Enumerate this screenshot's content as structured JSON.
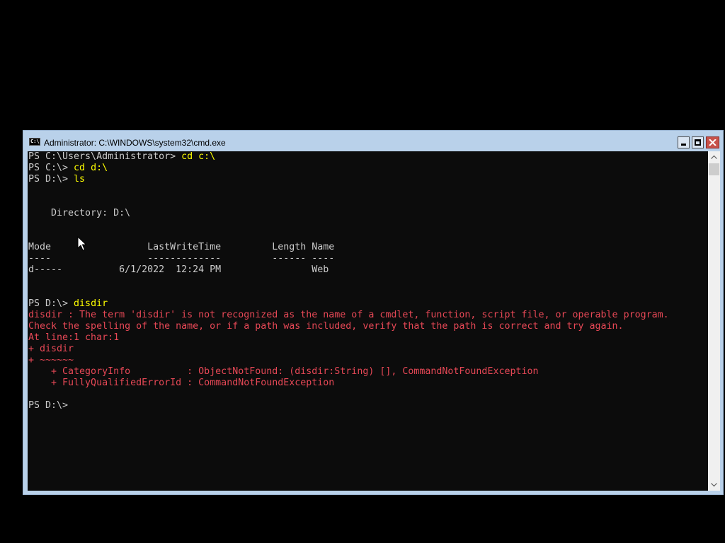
{
  "window": {
    "title": "Administrator: C:\\WINDOWS\\system32\\cmd.exe",
    "icon": "console-app-icon",
    "controls": {
      "minimize": "minimize-icon",
      "maximize": "maximize-icon",
      "close": "close-icon"
    }
  },
  "colors": {
    "titlebar": "#b9d1ea",
    "console_background": "#0c0c0c",
    "console_text": "#cccccc",
    "error_text": "#e74856",
    "command_text": "#ffff00",
    "close_button": "#c7514a"
  },
  "console": {
    "lines": [
      {
        "type": "input",
        "prompt": "PS C:\\Users\\Administrator> ",
        "command": "cd c:\\"
      },
      {
        "type": "input",
        "prompt": "PS C:\\> ",
        "command": "cd d:\\"
      },
      {
        "type": "input",
        "prompt": "PS D:\\> ",
        "command": "ls"
      },
      {
        "type": "output",
        "text": ""
      },
      {
        "type": "output",
        "text": ""
      },
      {
        "type": "output",
        "text": "    Directory: D:\\"
      },
      {
        "type": "output",
        "text": ""
      },
      {
        "type": "output",
        "text": ""
      },
      {
        "type": "output",
        "text": "Mode                 LastWriteTime         Length Name"
      },
      {
        "type": "output",
        "text": "----                 -------------         ------ ----"
      },
      {
        "type": "output",
        "text": "d-----          6/1/2022  12:24 PM                Web"
      },
      {
        "type": "output",
        "text": ""
      },
      {
        "type": "output",
        "text": ""
      },
      {
        "type": "input",
        "prompt": "PS D:\\> ",
        "command": "disdir"
      },
      {
        "type": "error",
        "text": "disdir : The term 'disdir' is not recognized as the name of a cmdlet, function, script file, or operable program."
      },
      {
        "type": "error",
        "text": "Check the spelling of the name, or if a path was included, verify that the path is correct and try again."
      },
      {
        "type": "error",
        "text": "At line:1 char:1"
      },
      {
        "type": "error",
        "text": "+ disdir"
      },
      {
        "type": "error",
        "text": "+ ~~~~~~"
      },
      {
        "type": "error",
        "text": "    + CategoryInfo          : ObjectNotFound: (disdir:String) [], CommandNotFoundException"
      },
      {
        "type": "error",
        "text": "    + FullyQualifiedErrorId : CommandNotFoundException"
      },
      {
        "type": "output",
        "text": ""
      },
      {
        "type": "input",
        "prompt": "PS D:\\> ",
        "command": ""
      }
    ]
  },
  "scrollbar": {
    "up_icon": "scroll-up-arrow-icon",
    "down_icon": "scroll-down-arrow-icon"
  },
  "pointer": "mouse-pointer-icon"
}
